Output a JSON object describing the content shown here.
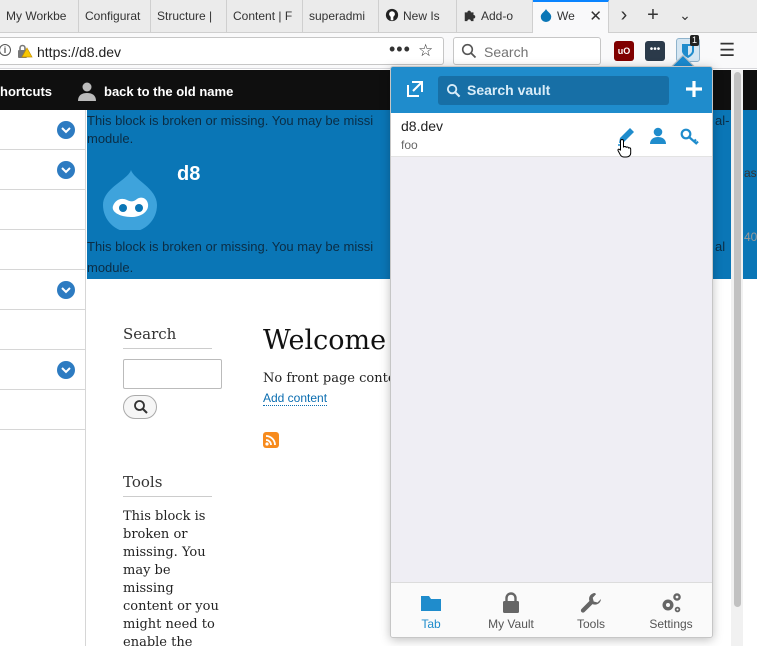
{
  "browser": {
    "tabs": [
      {
        "title": "My Workbe"
      },
      {
        "title": "Configurat"
      },
      {
        "title": "Structure |"
      },
      {
        "title": "Content | F"
      },
      {
        "title": "superadmi"
      },
      {
        "title": "New Is"
      },
      {
        "title": "Add-o"
      },
      {
        "title": "We"
      }
    ],
    "tab_overflow_icon": "chevron-right-icon",
    "new_tab_icon": "plus-icon",
    "tab_list_icon": "chevron-down-icon",
    "url": "https://d8.dev",
    "search_placeholder": "Search",
    "ext_badge": "1"
  },
  "drupal": {
    "toolbar": {
      "shortcuts_label": "hortcuts",
      "user_label": "back to the old name"
    },
    "header": {
      "broken_text_1a": "This block is broken or missing. You may be missi",
      "broken_text_1b": "module.",
      "broken_text_1c": "al-",
      "site_name": "d8",
      "broken_text_2a": "This block is broken or missing. You may be missi",
      "broken_text_2b": "module.",
      "broken_text_2c": "al"
    },
    "sidebar": {
      "search_title": "Search",
      "tools_title": "Tools",
      "tools_text": "This block is broken or missing. You may be missing content or you might need to enable the original"
    },
    "main": {
      "welcome": "Welcome t",
      "no_front": "No front page conten",
      "add_content": "Add content"
    },
    "right_peek": {
      "line1": "as",
      "line2": "40"
    }
  },
  "vault_popup": {
    "search_placeholder": "Search vault",
    "item": {
      "name": "d8.dev",
      "username": "foo"
    },
    "tabs": [
      {
        "label": "Tab",
        "icon": "folder-icon",
        "active": true
      },
      {
        "label": "My Vault",
        "icon": "lock-icon",
        "active": false
      },
      {
        "label": "Tools",
        "icon": "wrench-icon",
        "active": false
      },
      {
        "label": "Settings",
        "icon": "gears-icon",
        "active": false
      }
    ],
    "accent": "#1f8ccc"
  }
}
